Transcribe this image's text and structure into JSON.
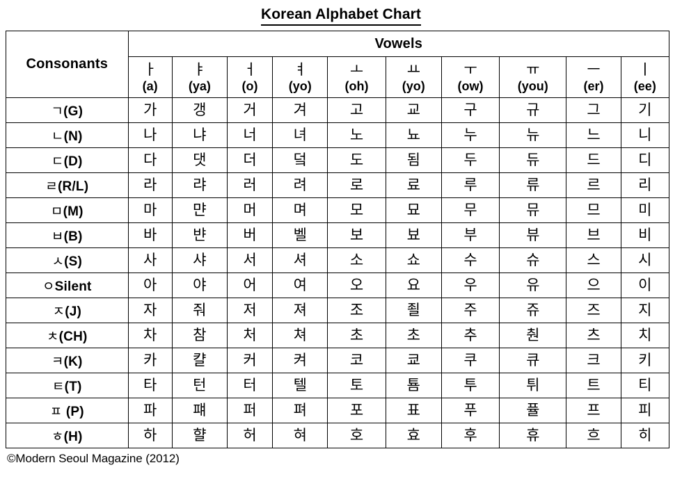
{
  "title": "Korean Alphabet Chart",
  "table": {
    "consonants_header": "Consonants",
    "vowels_header": "Vowels",
    "vowels": [
      {
        "jamo": "ㅏ",
        "roman": "(a)"
      },
      {
        "jamo": "ㅑ",
        "roman": "(ya)"
      },
      {
        "jamo": "ㅓ",
        "roman": "(o)"
      },
      {
        "jamo": "ㅕ",
        "roman": "(yo)"
      },
      {
        "jamo": "ㅗ",
        "roman": "(oh)"
      },
      {
        "jamo": "ㅛ",
        "roman": "(yo)"
      },
      {
        "jamo": "ㅜ",
        "roman": "(ow)"
      },
      {
        "jamo": "ㅠ",
        "roman": "(you)"
      },
      {
        "jamo": "ㅡ",
        "roman": "(er)"
      },
      {
        "jamo": "ㅣ",
        "roman": "(ee)"
      }
    ],
    "rows": [
      {
        "consonant_jamo": "ㄱ",
        "consonant_label": "(G)",
        "syllables": [
          "가",
          "갱",
          "거",
          "겨",
          "고",
          "교",
          "구",
          "규",
          "그",
          "기"
        ]
      },
      {
        "consonant_jamo": "ㄴ",
        "consonant_label": "(N)",
        "syllables": [
          "나",
          "냐",
          "너",
          "녀",
          "노",
          "뇨",
          "누",
          "뉴",
          "느",
          "니"
        ]
      },
      {
        "consonant_jamo": "ㄷ",
        "consonant_label": "(D)",
        "syllables": [
          "다",
          "댓",
          "더",
          "덬",
          "도",
          "됨",
          "두",
          "듀",
          "드",
          "디"
        ]
      },
      {
        "consonant_jamo": "ㄹ",
        "consonant_label": "(R/L)",
        "syllables": [
          "라",
          "랴",
          "러",
          "려",
          "로",
          "료",
          "루",
          "류",
          "르",
          "리"
        ]
      },
      {
        "consonant_jamo": "ㅁ",
        "consonant_label": "(M)",
        "syllables": [
          "마",
          "먄",
          "머",
          "며",
          "모",
          "묘",
          "무",
          "뮤",
          "므",
          "미"
        ]
      },
      {
        "consonant_jamo": "ㅂ",
        "consonant_label": "(B)",
        "syllables": [
          "바",
          "뱐",
          "버",
          "벨",
          "보",
          "뵤",
          "부",
          "뷰",
          "브",
          "비"
        ]
      },
      {
        "consonant_jamo": "ㅅ",
        "consonant_label": "(S)",
        "syllables": [
          "사",
          "샤",
          "서",
          "셔",
          "소",
          "쇼",
          "수",
          "슈",
          "스",
          "시"
        ]
      },
      {
        "consonant_jamo": "ㅇ",
        "consonant_label": "Silent",
        "syllables": [
          "아",
          "야",
          "어",
          "여",
          "오",
          "요",
          "우",
          "유",
          "으",
          "이"
        ]
      },
      {
        "consonant_jamo": "ㅈ",
        "consonant_label": "(J)",
        "syllables": [
          "자",
          "줘",
          "저",
          "져",
          "조",
          "죌",
          "주",
          "쥬",
          "즈",
          "지"
        ]
      },
      {
        "consonant_jamo": "ㅊ",
        "consonant_label": "(CH)",
        "syllables": [
          "차",
          "참",
          "처",
          "쳐",
          "초",
          "초",
          "추",
          "춴",
          "츠",
          "치"
        ]
      },
      {
        "consonant_jamo": "ㅋ",
        "consonant_label": "(K)",
        "syllables": [
          "카",
          "캴",
          "커",
          "켜",
          "코",
          "쿄",
          "쿠",
          "큐",
          "크",
          "키"
        ]
      },
      {
        "consonant_jamo": "ㅌ",
        "consonant_label": "(T)",
        "syllables": [
          "타",
          "턴",
          "터",
          "텔",
          "토",
          "툠",
          "투",
          "튀",
          "트",
          "티"
        ]
      },
      {
        "consonant_jamo": "ㅍ",
        "consonant_label": " (P)",
        "syllables": [
          "파",
          "퍠",
          "퍼",
          "펴",
          "포",
          "표",
          "푸",
          "퓰",
          "프",
          "피"
        ]
      },
      {
        "consonant_jamo": "ㅎ",
        "consonant_label": "(H)",
        "syllables": [
          "하",
          "햘",
          "허",
          "혀",
          "호",
          "효",
          "후",
          "휴",
          "흐",
          "히"
        ]
      }
    ]
  },
  "footer": "©Modern Seoul Magazine (2012)"
}
